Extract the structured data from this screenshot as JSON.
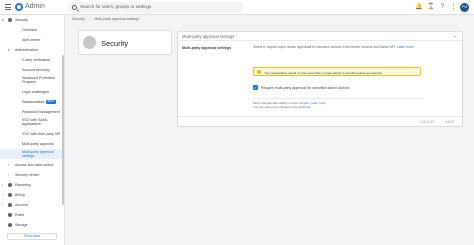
{
  "topbar": {
    "app_title": "Admin",
    "search_placeholder": "Search for users, groups or settings",
    "avatar_initials": "PM",
    "icons": [
      "bell-icon",
      "hourglass-icon",
      "help-icon",
      "apps-icon"
    ]
  },
  "breadcrumb": [
    "Security",
    "Multi-party approval settings"
  ],
  "sidebar": {
    "items": [
      {
        "label": "Security",
        "level": "top",
        "expanded": true
      },
      {
        "label": "Overview",
        "level": "child"
      },
      {
        "label": "Alert center",
        "level": "child"
      },
      {
        "label": "Authentication",
        "level": "section",
        "expanded": true
      },
      {
        "label": "2-step verification",
        "level": "child"
      },
      {
        "label": "Account recovery",
        "level": "child"
      },
      {
        "label": "Advanced Protection",
        "level": "child"
      },
      {
        "label": "Program",
        "level": "child"
      },
      {
        "label": "Login challenges",
        "level": "child"
      },
      {
        "label": "Passwordless",
        "level": "child",
        "badge": "BETA"
      },
      {
        "label": "Password management",
        "level": "child"
      },
      {
        "label": "SSO with SAML",
        "level": "child"
      },
      {
        "label": "applications",
        "level": "child"
      },
      {
        "label": "SSO with third party IdP",
        "level": "child"
      },
      {
        "label": "Multi-party approval",
        "level": "child"
      },
      {
        "label": "Multi-party approval",
        "level": "child",
        "active": true
      },
      {
        "label": "settings",
        "level": "child",
        "active": true
      },
      {
        "label": "Access and data control",
        "level": "section"
      },
      {
        "label": "Security center",
        "level": "section"
      },
      {
        "label": "Reporting",
        "level": "top"
      },
      {
        "label": "Billing",
        "level": "top"
      },
      {
        "label": "Account",
        "level": "top"
      },
      {
        "label": "Rules",
        "level": "top"
      },
      {
        "label": "Storage",
        "level": "top"
      }
    ],
    "show_less": "Show less"
  },
  "security_card": {
    "title": "Security"
  },
  "panel": {
    "title": "Multi-party approval settings",
    "field_label": "Multi-party approval settings",
    "desc_line1": "Select to require super admin approvals for sensitive actions in the Admin console and Admin API.",
    "desc_link": "Learn more",
    "warning": "Your organization needs to have more than 1 super admin to use this feature as intended",
    "checkbox_label": "Require multi-party approval for sensitive admin actions",
    "checkbox_checked": true,
    "note_line1": "Most changes take effect in a few minutes.",
    "note_link1": "Learn more",
    "note_line2": "You can view prior changes in the",
    "note_link2": "Audit log",
    "cancel": "CANCEL",
    "save": "SAVE"
  }
}
